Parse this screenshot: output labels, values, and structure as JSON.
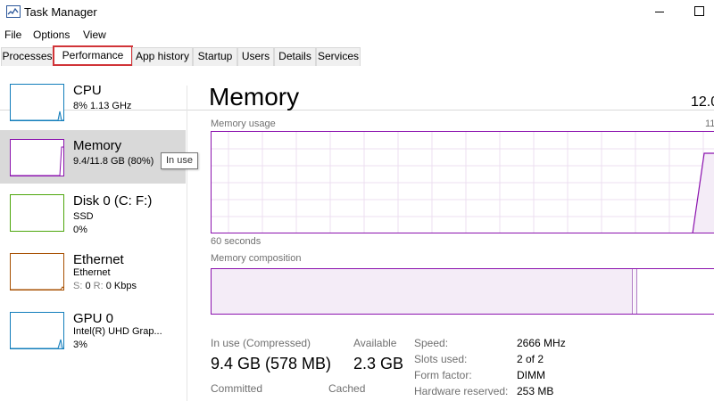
{
  "window": {
    "title": "Task Manager"
  },
  "menu": [
    "File",
    "Options",
    "View"
  ],
  "tabs": [
    {
      "label": "Processes",
      "active": false
    },
    {
      "label": "Performance",
      "active": true
    },
    {
      "label": "App history",
      "active": false
    },
    {
      "label": "Startup",
      "active": false
    },
    {
      "label": "Users",
      "active": false
    },
    {
      "label": "Details",
      "active": false
    },
    {
      "label": "Services",
      "active": false
    }
  ],
  "sidebar": {
    "items": [
      {
        "name": "CPU",
        "line1": "8%  1.13 GHz",
        "color": "#117dbb",
        "selected": false
      },
      {
        "name": "Memory",
        "line1": "9.4/11.8 GB (80%)",
        "color": "#8b12ae",
        "selected": true
      },
      {
        "name": "Disk 0 (C: F:)",
        "line1": "SSD",
        "line2": "0%",
        "color": "#4da60c",
        "selected": false
      },
      {
        "name": "Ethernet",
        "line1": "Ethernet",
        "line2_send_label": "S:",
        "line2_send_value": "0",
        "line2_recv_label": "R:",
        "line2_recv_value": "0 Kbps",
        "color": "#a74f01",
        "selected": false
      },
      {
        "name": "GPU 0",
        "line1": "Intel(R) UHD Grap...",
        "line2": "3%",
        "color": "#117dbb",
        "selected": false
      }
    ],
    "tooltip": "In use"
  },
  "main": {
    "title": "Memory",
    "total_capacity": "12.0",
    "usage_label": "Memory usage",
    "usage_max": "11",
    "time_label": "60 seconds",
    "composition_label": "Memory composition",
    "accent_color": "#8b12ae",
    "stats": {
      "in_use_label": "In use (Compressed)",
      "in_use_value": "9.4 GB (578 MB)",
      "available_label": "Available",
      "available_value": "2.3 GB",
      "committed_label": "Committed",
      "cached_label": "Cached"
    },
    "details": [
      {
        "label": "Speed:",
        "value": "2666 MHz"
      },
      {
        "label": "Slots used:",
        "value": "2 of 2"
      },
      {
        "label": "Form factor:",
        "value": "DIMM"
      },
      {
        "label": "Hardware reserved:",
        "value": "253 MB"
      }
    ]
  }
}
